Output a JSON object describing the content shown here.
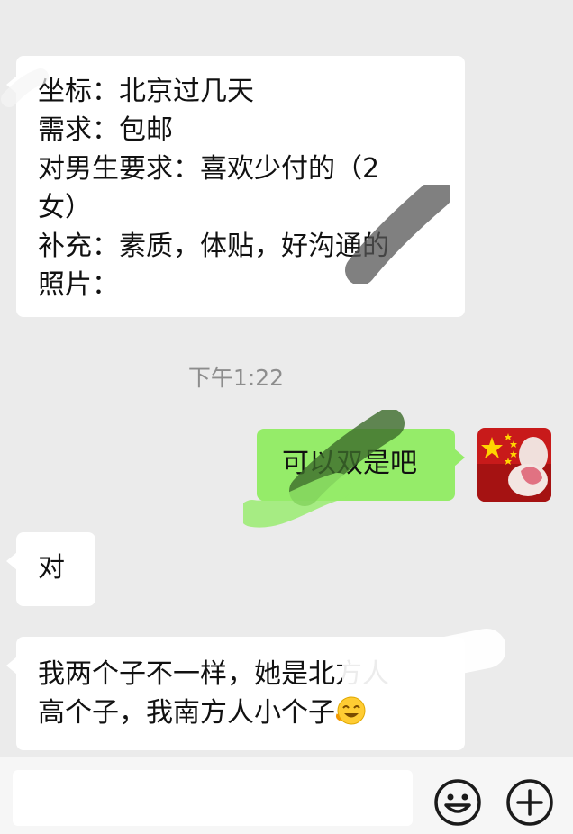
{
  "messages": [
    {
      "side": "left",
      "lines": [
        "坐标：北京过几天",
        "需求：包邮",
        "对男生要求：喜欢少付的（2",
        "女）",
        "补充：素质，体贴，好沟通的",
        "照片："
      ]
    },
    {
      "timestamp": "下午1:22"
    },
    {
      "side": "right",
      "text": "可以双是吧",
      "avatar": "red-flag-avatar"
    },
    {
      "side": "left",
      "text": "对"
    },
    {
      "side": "left",
      "lines": [
        "我两个子不一样，她是北方人",
        "高个子，我南方人小个子"
      ],
      "trailing_emoji": "laughing-face-emoji"
    }
  ],
  "input_bar": {
    "value": "",
    "icons": [
      "emoji-icon",
      "plus-icon"
    ]
  },
  "colors": {
    "background": "#ebebeb",
    "bubble_received": "#ffffff",
    "bubble_sent": "#95ec69",
    "timestamp": "#8d8d8d"
  }
}
